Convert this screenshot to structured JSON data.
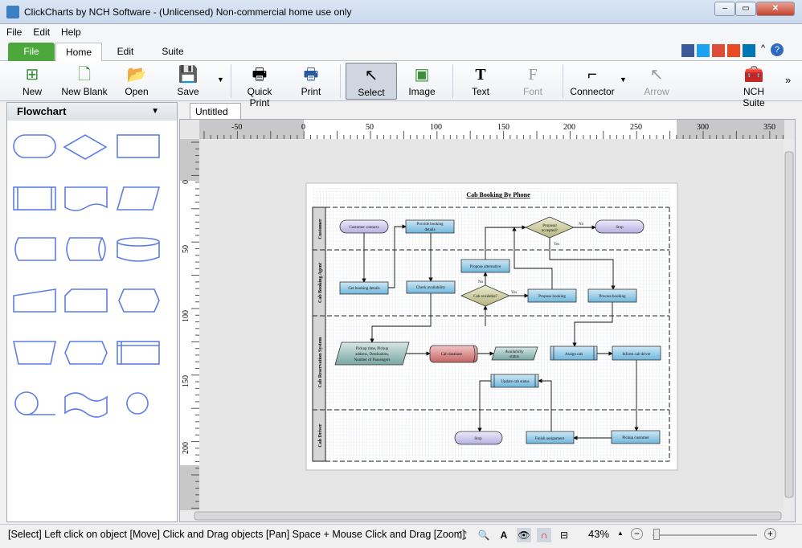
{
  "window": {
    "title": "ClickCharts by NCH Software - (Unlicensed) Non-commercial home use only"
  },
  "menu": [
    "File",
    "Edit",
    "Help"
  ],
  "ribbon_tabs": [
    "File",
    "Home",
    "Edit",
    "Suite"
  ],
  "toolbar": [
    {
      "label": "New",
      "icon": "new-icon"
    },
    {
      "label": "New Blank",
      "icon": "new-blank-icon"
    },
    {
      "label": "Open",
      "icon": "open-icon"
    },
    {
      "label": "Save",
      "icon": "save-icon"
    },
    {
      "label": "Quick Print",
      "icon": "quick-print-icon"
    },
    {
      "label": "Print",
      "icon": "print-icon"
    },
    {
      "label": "Select",
      "icon": "select-cursor-icon"
    },
    {
      "label": "Image",
      "icon": "image-icon"
    },
    {
      "label": "Text",
      "icon": "text-icon"
    },
    {
      "label": "Font",
      "icon": "font-icon"
    },
    {
      "label": "Connector",
      "icon": "connector-icon"
    },
    {
      "label": "Arrow",
      "icon": "arrow-icon"
    },
    {
      "label": "NCH Suite",
      "icon": "nch-suite-icon"
    }
  ],
  "sidebar": {
    "title": "Flowchart"
  },
  "doc_tab": "Untitled",
  "ruler": {
    "h": [
      "-50",
      "0",
      "50",
      "100",
      "150",
      "200",
      "250",
      "300",
      "350"
    ],
    "v": [
      "0",
      "50",
      "100",
      "150",
      "200"
    ]
  },
  "diagram": {
    "title": "Cab Booking By Phone",
    "lanes": [
      "Customer",
      "Cab Booking Agent",
      "Cab Reservation System",
      "Cab Driver"
    ],
    "nodes": {
      "customer_contacts": "Customer contacts",
      "provide_details1": "Provide booking",
      "provide_details2": "details",
      "proposal1": "Proposal",
      "proposal2": "accepted?",
      "stop1": "Stop",
      "propose_alt": "Propose alternative",
      "get_details": "Get booking details",
      "check_avail": "Check availability",
      "cab_avail": "Cab available?",
      "propose_booking": "Propose booking",
      "process_booking": "Process booking",
      "pickup1": "Pickup time, Pickup",
      "pickup2": "address, Destination,",
      "pickup3": "Number of Passengers",
      "cab_db": "Cab database",
      "avail1": "Availability",
      "avail2": "status",
      "assign_cab": "Assign cab",
      "inform_driver": "Inform cab driver",
      "update_status": "Update cab status",
      "stop2": "Stop",
      "finish": "Finish assignment",
      "pickup_customer": "Pickup customer"
    },
    "labels": {
      "no1": "No",
      "yes1": "Yes",
      "no2": "No",
      "yes2": "Yes"
    }
  },
  "status": {
    "message": "[Select] Left click on object  [Move] Click and Drag objects  [Pan] Space + Mouse Click and Drag  [Zoom]",
    "zoom": "43%"
  },
  "zoom_level_percent": 43,
  "colors": {
    "process_fill": "#8ec9e6",
    "terminator_fill": "#c9c4ea",
    "decision_fill": "#c9c99a",
    "database_fill": "#d98888",
    "io_fill": "#8fb8b4",
    "file_tab": "#4ca83c"
  }
}
